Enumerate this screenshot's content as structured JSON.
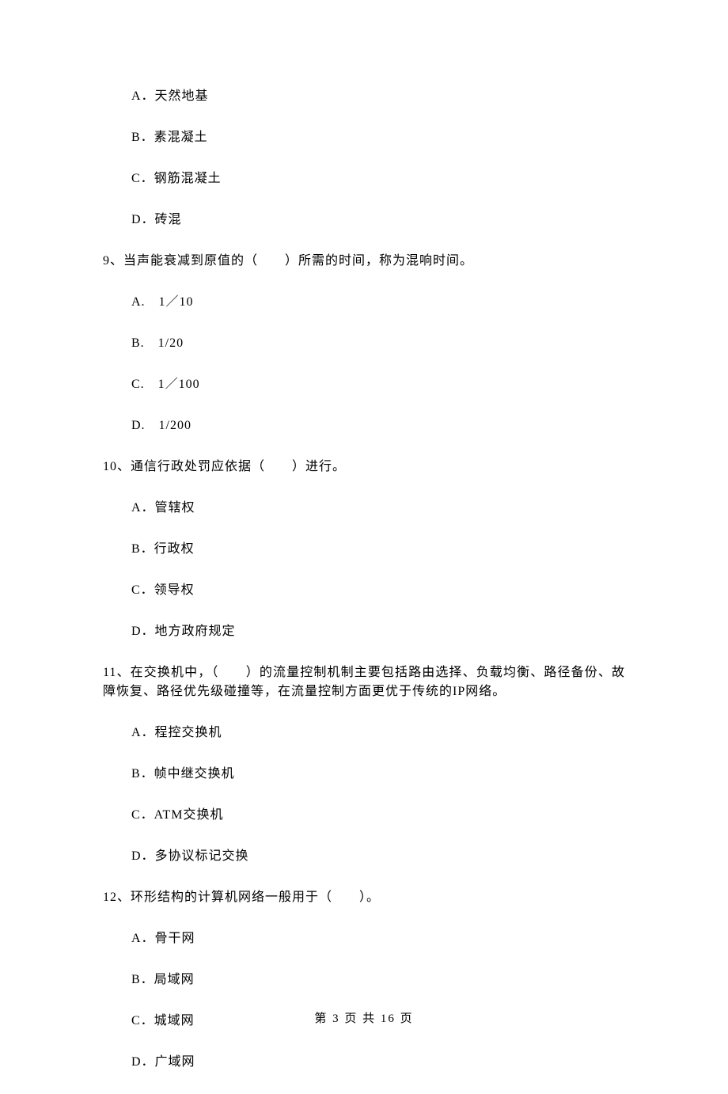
{
  "prev_options": {
    "a": "A．天然地基",
    "b": "B．素混凝土",
    "c": "C．钢筋混凝土",
    "d": "D．砖混"
  },
  "q9": {
    "stem": "9、当声能衰减到原值的（　　）所需的时间，称为混响时间。",
    "a": "A.　1／10",
    "b": "B.　1/20",
    "c": "C.　1／100",
    "d": "D.　1/200"
  },
  "q10": {
    "stem": "10、通信行政处罚应依据（　　）进行。",
    "a": "A．管辖权",
    "b": "B．行政权",
    "c": "C．领导权",
    "d": "D．地方政府规定"
  },
  "q11": {
    "stem": "11、在交换机中，（　　）的流量控制机制主要包括路由选择、负载均衡、路径备份、故障恢复、路径优先级碰撞等，在流量控制方面更优于传统的IP网络。",
    "a": "A．程控交换机",
    "b": "B．帧中继交换机",
    "c": "C．ATM交换机",
    "d": "D．多协议标记交换"
  },
  "q12": {
    "stem": "12、环形结构的计算机网络一般用于（　　）。",
    "a": "A．骨干网",
    "b": "B．局域网",
    "c": "C．城域网",
    "d": "D．广域网"
  },
  "footer": "第 3 页 共 16 页"
}
